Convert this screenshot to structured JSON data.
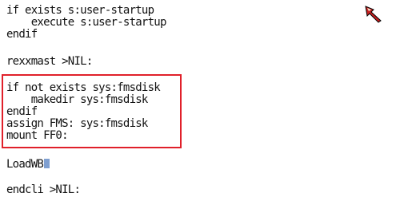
{
  "editor": {
    "lines": [
      "if exists s:user-startup",
      "    execute s:user-startup",
      "endif",
      "",
      "rexxmast >NIL:",
      "",
      "if not exists sys:fmsdisk",
      "    makedir sys:fmsdisk",
      "endif",
      "assign FMS: sys:fmsdisk",
      "mount FF0:",
      "",
      "LoadWB",
      "",
      "endcli >NIL:"
    ]
  },
  "colors": {
    "background": "#ffffff",
    "text": "#111111",
    "highlight_border": "#e0202a",
    "cursor": "#7f9fd0",
    "pointer": "#c82020"
  },
  "icons": {
    "pointer": "mouse-pointer-icon"
  }
}
